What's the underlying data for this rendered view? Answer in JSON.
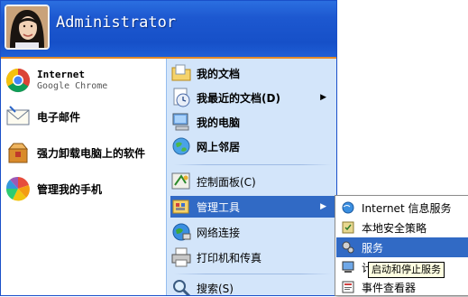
{
  "header": {
    "username": "Administrator",
    "avatar_icon": "user-avatar-photo",
    "accent_color": "#1d58d0"
  },
  "left_items": [
    {
      "label": "Internet",
      "sublabel": "Google Chrome",
      "icon": "chrome-icon"
    },
    {
      "label": "电子邮件",
      "icon": "email-icon"
    },
    {
      "label": "强力卸载电脑上的软件",
      "icon": "uninstall-icon"
    },
    {
      "label": "管理我的手机",
      "icon": "phone-manager-icon"
    }
  ],
  "right_items": [
    {
      "label": "我的文档",
      "icon": "my-documents-icon"
    },
    {
      "label": "我最近的文档(D)",
      "icon": "recent-documents-icon",
      "has_submenu": true
    },
    {
      "label": "我的电脑",
      "icon": "my-computer-icon"
    },
    {
      "label": "网上邻居",
      "icon": "network-places-icon"
    },
    {
      "label": "控制面板(C)",
      "icon": "control-panel-icon"
    },
    {
      "label": "管理工具",
      "icon": "admin-tools-icon",
      "has_submenu": true,
      "selected": true
    },
    {
      "label": "网络连接",
      "icon": "network-connections-icon"
    },
    {
      "label": "打印机和传真",
      "icon": "printers-icon"
    },
    {
      "label": "搜索(S)",
      "icon": "search-icon"
    }
  ],
  "submenu_items": [
    {
      "label": "Internet 信息服务",
      "icon": "iis-icon"
    },
    {
      "label": "本地安全策略",
      "icon": "security-policy-icon"
    },
    {
      "label": "服务",
      "icon": "services-icon",
      "selected": true
    },
    {
      "label": "计算机",
      "icon": "computer-management-icon"
    },
    {
      "label": "事件查看器",
      "icon": "event-viewer-icon"
    }
  ],
  "tooltip": "启动和停止服务",
  "colors": {
    "selection": "#316ac5",
    "right_pane": "#d3e5fa",
    "header_border": "#e28a2a"
  }
}
